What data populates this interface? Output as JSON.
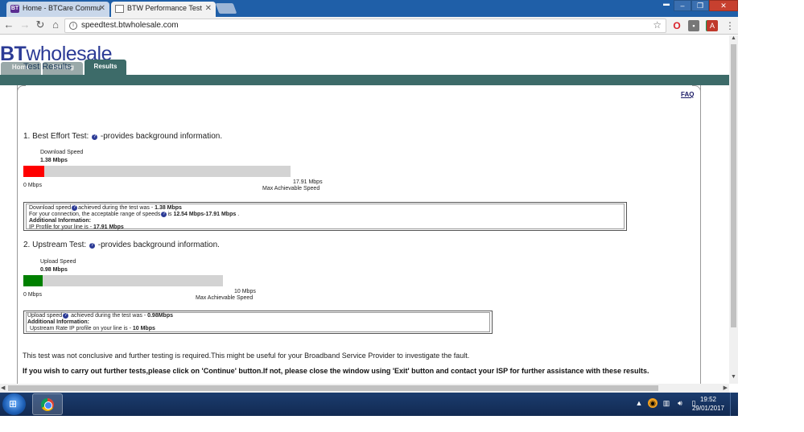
{
  "browser": {
    "tabs": [
      {
        "label": "Home - BTCare Commu",
        "favicon": "BT",
        "active": false
      },
      {
        "label": "BTW Performance Test",
        "favicon": "",
        "active": true
      }
    ],
    "url": "speedtest.btwholesale.com",
    "window_controls": {
      "minimize": "–",
      "restore": "❐",
      "close": "✕"
    },
    "icons": [
      "back-icon",
      "forward-icon",
      "reload-icon",
      "home-icon",
      "info-icon",
      "star-icon",
      "opera-icon",
      "extension-icon",
      "adblock-icon",
      "pdf-icon",
      "menu-icon"
    ]
  },
  "site": {
    "logo_bt": "BT",
    "logo_wholesale": "wholesale",
    "nav": {
      "home": "Home",
      "testing": "Testing",
      "results": "Results"
    },
    "faq": "FAQ",
    "title": "Test Results"
  },
  "download": {
    "heading_prefix": "1. Best Effort Test:",
    "heading_suffix": "-provides background information.",
    "label": "Download Speed",
    "value": "1.38 Mbps",
    "min_label": "0 Mbps",
    "max_label": "17.91 Mbps",
    "max_caption": "Max Achievable Speed",
    "fraction": 0.077,
    "bar_color": "#ff0000",
    "info": {
      "line1_prefix": "Download speed",
      "line1_middle": "achieved during the test was - ",
      "line1_value": "1.38 Mbps",
      "line2_prefix": "For your connection, the acceptable range of speeds",
      "line2_middle": "is ",
      "line2_value": "12.54 Mbps-17.91 Mbps",
      "line2_suffix": " .",
      "line3": "Additional Information:",
      "line4_prefix": "IP Profile for your line is - ",
      "line4_value": "17.91 Mbps"
    }
  },
  "upload": {
    "heading_prefix": "2. Upstream Test:",
    "heading_suffix": "-provides background information.",
    "label": "Upload Speed",
    "value": "0.98 Mbps",
    "min_label": "0 Mbps",
    "max_label": "10 Mbps",
    "max_caption": "Max Achievable Speed",
    "fraction": 0.098,
    "bar_color": "#008000",
    "info": {
      "line1_prefix": "Upload speed",
      "line1_middle": " achieved during the test was - ",
      "line1_value": "0.98Mbps",
      "line2": "Additional Information:",
      "line3_prefix": "Upstream Rate IP profile on your line is - ",
      "line3_value": "10 Mbps"
    }
  },
  "messages": {
    "inconclusive": "This test was not conclusive and further testing is required.This might be useful for your Broadband Service Provider to investigate the fault.",
    "instructions": "If you wish to carry out further tests,please click on 'Continue' button.If not, please close the window using 'Exit' button and contact your ISP for further assistance with these results."
  },
  "taskbar": {
    "time": "19:52",
    "date": "29/01/2017",
    "tray_arrow": "▲"
  }
}
